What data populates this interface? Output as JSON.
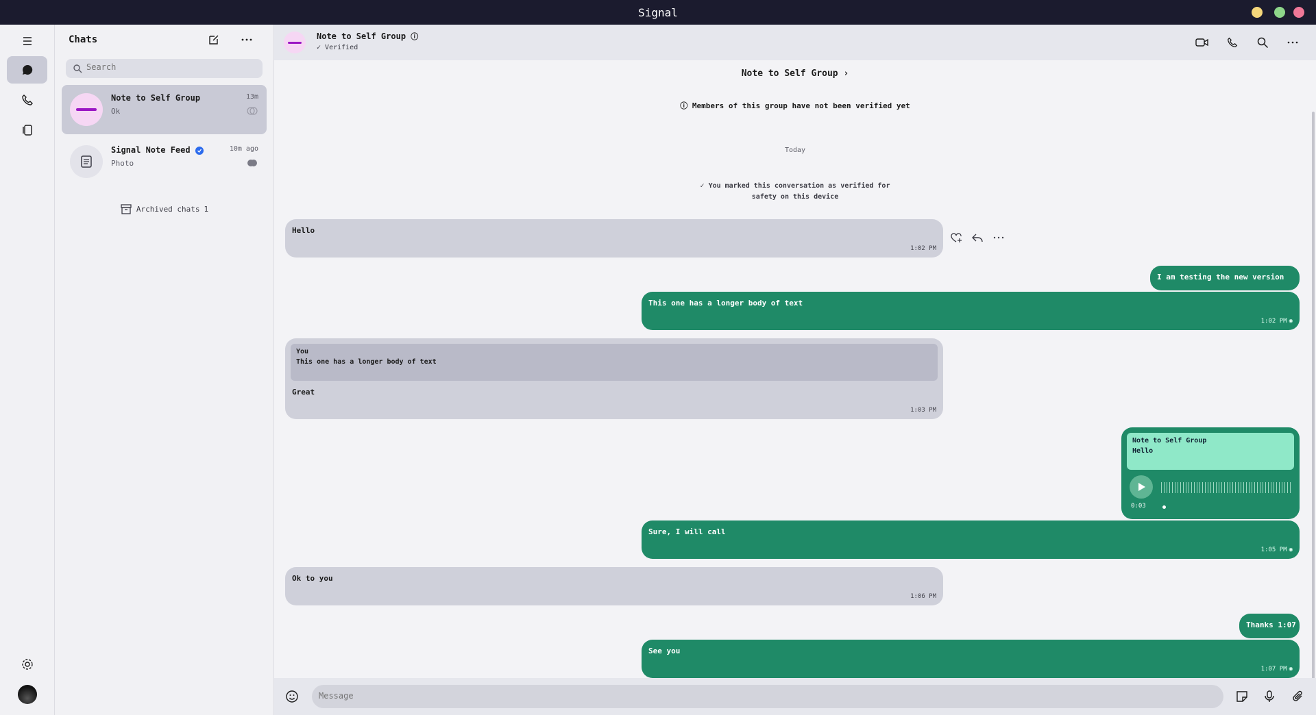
{
  "window": {
    "title": "Signal",
    "controls": {
      "minimize_color": "#f5d77b",
      "maximize_color": "#8ed68a",
      "close_color": "#f07898"
    }
  },
  "rail": {
    "items": [
      {
        "name": "menu-icon",
        "active": false
      },
      {
        "name": "chats-icon",
        "active": true
      },
      {
        "name": "calls-icon",
        "active": false
      },
      {
        "name": "stories-icon",
        "active": false
      }
    ],
    "settings_icon": "gear-icon",
    "avatar_icon": "profile-avatar"
  },
  "list": {
    "title": "Chats",
    "compose_icon": "compose-icon",
    "more_icon": "more-icon",
    "search": {
      "placeholder": "Search"
    },
    "items": [
      {
        "name": "Note to Self Group",
        "time": "13m",
        "preview": "Ok",
        "selected": true,
        "avatar_color": "#f6d7f4",
        "avatar_mark_color": "#9b17c4"
      },
      {
        "name": "Signal Note Feed",
        "time": "10m ago",
        "preview": "Photo",
        "selected": false,
        "avatar_color": "#e3e3ea",
        "verified": true
      }
    ],
    "archived": {
      "label": "Archived chats",
      "count": "1"
    }
  },
  "conversation": {
    "header": {
      "name": "Note to Self Group",
      "status": "Verified"
    },
    "intro": {
      "title": "Note to Self Group",
      "notice": "Members of this group have not been verified yet",
      "date_divider": "Today",
      "system_line1": "You marked this conversation as verified for",
      "system_line2": "safety on this device"
    },
    "hover_actions": [
      "react-icon",
      "reply-icon",
      "more-icon"
    ],
    "messages": [
      {
        "dir": "in",
        "text": "Hello",
        "time": "1:02 PM"
      },
      {
        "dir": "out",
        "text": "I am testing the new version",
        "time": "",
        "short": true
      },
      {
        "dir": "out",
        "text": "This one has a longer body of text",
        "time": "1:02 PM",
        "read": true
      },
      {
        "dir": "in",
        "quote_title": "You",
        "quote_text": "This one has a longer body of text",
        "text": "Great",
        "time": "1:03 PM"
      },
      {
        "dir": "out",
        "quote_title": "Note to Self Group",
        "quote_text": "Hello",
        "voice": {
          "duration": "0:03"
        }
      },
      {
        "dir": "out",
        "text": "Sure, I will call",
        "time": "1:05 PM",
        "read": true
      },
      {
        "dir": "in",
        "text": "Ok to you",
        "time": "1:06 PM"
      },
      {
        "dir": "out",
        "text": "Thanks",
        "time": "1:07",
        "short": true
      },
      {
        "dir": "out",
        "text": "See you",
        "time": "1:07 PM",
        "read": true
      }
    ]
  },
  "composer": {
    "placeholder": "Message"
  },
  "colors": {
    "accent": "#1f8a67",
    "incoming": "#cfd0da",
    "quote_out": "#8fe8c8",
    "quote_in": "#b9bac8"
  }
}
